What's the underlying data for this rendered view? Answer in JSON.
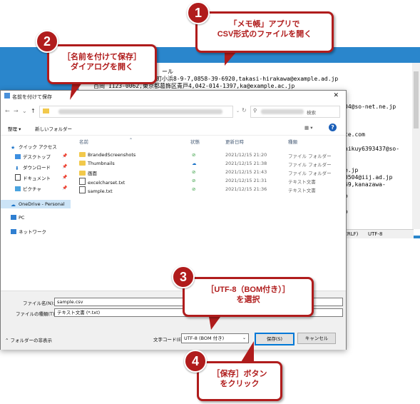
{
  "notepad": {
    "lines": [
      "ール",
      "郡湯梨浜町小浜8-9-7,0858-39-6920,takasi-hirakawa@example.ad.jp",
      "百岡 1123-0062,東京都葛飾区青戸4,042-014-1397,ka@example.ac.jp",
      "04@so-net.ne.jp",
      "te.com",
      "hikuy6393437@so-",
      "e.jp",
      "0504@iij.ad.jp",
      "69,kanazawa-",
      "o",
      "o"
    ],
    "status_eol": "CRLF)",
    "status_enc": "UTF-8"
  },
  "dialog": {
    "title": "名前を付けて保存",
    "close": "✕",
    "search_placeholder": "検索",
    "toolbar": {
      "organize": "整理 ▾",
      "new_folder": "新しいフォルダー",
      "view": "▦ ▾",
      "help": "?"
    },
    "sidebar": [
      {
        "label": "クイック アクセス",
        "icon": "star-icon"
      },
      {
        "label": "デスクトップ",
        "icon": "desktop-icon"
      },
      {
        "label": "ダウンロード",
        "icon": "download-icon"
      },
      {
        "label": "ドキュメント",
        "icon": "document-icon"
      },
      {
        "label": "ピクチャ",
        "icon": "picture-icon"
      },
      {
        "label": "OneDrive - Personal",
        "icon": "cloud-icon"
      },
      {
        "label": "PC",
        "icon": "pc-icon"
      },
      {
        "label": "ネットワーク",
        "icon": "network-icon"
      }
    ],
    "columns": {
      "name": "名前",
      "status": "状態",
      "date": "更新日時",
      "type": "種類"
    },
    "files": [
      {
        "name": "BrandedScreenshots",
        "status": "⊘",
        "date": "2021/12/15 21:20",
        "type": "ファイル フォルダー",
        "kind": "folder"
      },
      {
        "name": "Thumbnails",
        "status": "☁",
        "date": "2021/12/15 21:38",
        "type": "ファイル フォルダー",
        "kind": "folder"
      },
      {
        "name": "画面",
        "status": "⊘",
        "date": "2021/12/15 21:43",
        "type": "ファイル フォルダー",
        "kind": "folder"
      },
      {
        "name": "excelcharset.txt",
        "status": "⊘",
        "date": "2021/12/15 21:31",
        "type": "テキスト文書",
        "kind": "file"
      },
      {
        "name": "sample.txt",
        "status": "⊘",
        "date": "2021/12/15 21:36",
        "type": "テキスト文書",
        "kind": "file"
      }
    ],
    "filename_label": "ファイル名(N):",
    "filename_value": "sample.csv",
    "filetype_label": "ファイルの種類(T):",
    "filetype_value": "テキスト文書 (*.txt)",
    "hide_folders": "フォルダーの非表示",
    "encoding_label": "文字コード(E):",
    "encoding_value": "UTF-8 (BOM 付き)",
    "save": "保存(S)",
    "cancel": "キャンセル"
  },
  "callouts": [
    {
      "num": "1",
      "lines": [
        "「メモ帳」アプリで",
        "CSV形式のファイルを開く"
      ]
    },
    {
      "num": "2",
      "lines": [
        "［名前を付けて保存］",
        "ダイアログを開く"
      ]
    },
    {
      "num": "3",
      "lines": [
        "［UTF-8（BOM付き）］",
        "を選択"
      ]
    },
    {
      "num": "4",
      "lines": [
        "［保存］ボタン",
        "をクリック"
      ]
    }
  ]
}
